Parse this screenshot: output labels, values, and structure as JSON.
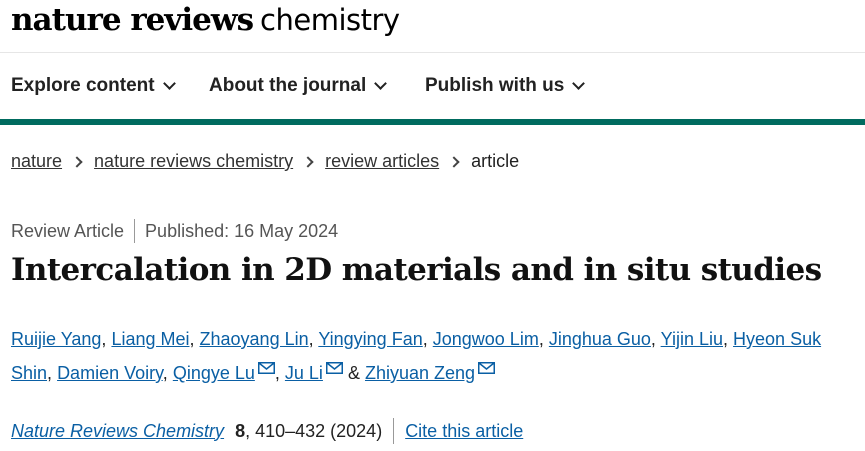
{
  "header": {
    "brand": "nature reviews",
    "journal": "chemistry"
  },
  "nav": {
    "items": [
      {
        "label": "Explore content",
        "icon": "chevron-down-icon"
      },
      {
        "label": "About the journal",
        "icon": "chevron-down-icon"
      },
      {
        "label": "Publish with us",
        "icon": "chevron-down-icon"
      }
    ]
  },
  "accent_color": "#006b5f",
  "link_color": "#0a5fa4",
  "breadcrumb": {
    "items": [
      "nature",
      "nature reviews chemistry",
      "review articles"
    ],
    "current": "article"
  },
  "article": {
    "type": "Review Article",
    "published": "Published: 16 May 2024",
    "title": "Intercalation in 2D materials and in situ studies",
    "authors": {
      "a1": "Ruijie Yang",
      "a2": "Liang Mei",
      "a3": "Zhaoyang Lin",
      "a4": "Yingying Fan",
      "a5": "Jongwoo Lim",
      "a6": "Jinghua Guo",
      "a7": "Yijin Liu",
      "a8": "Hyeon Suk Shin",
      "a9": "Damien Voiry",
      "a10": "Qingye Lu",
      "a11": "Ju Li",
      "a12": "Zhiyuan Zeng"
    },
    "sep_comma": ",",
    "sep_and": "&",
    "citation": {
      "journal": "Nature Reviews Chemistry",
      "volume": "8",
      "pages": ", 410–432 (2024)",
      "cite_label": "Cite this article"
    }
  }
}
